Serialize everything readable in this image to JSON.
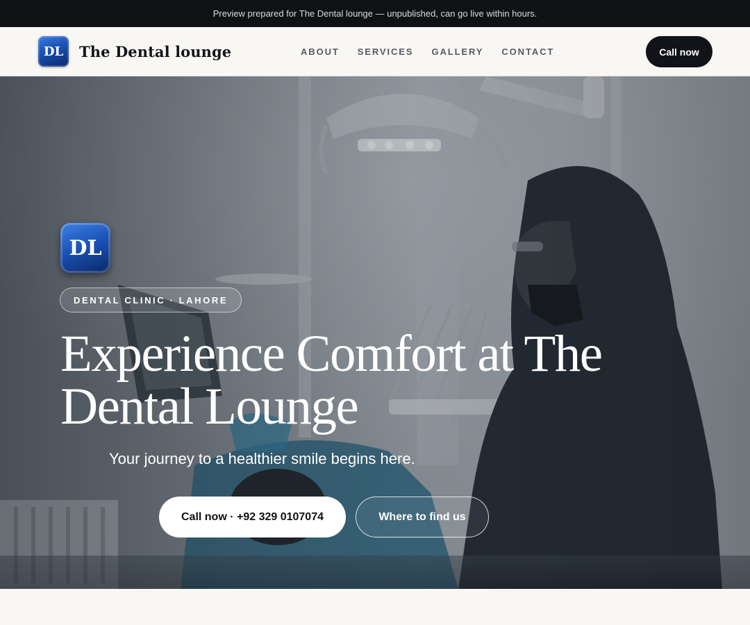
{
  "banner": {
    "text": "Preview prepared for The Dental lounge — unpublished, can go live within hours."
  },
  "header": {
    "logo_initials": "DL",
    "brand_name": "The Dental lounge",
    "nav": [
      "ABOUT",
      "SERVICES",
      "GALLERY",
      "CONTACT"
    ],
    "cta_label": "Call now"
  },
  "hero": {
    "badge_initials": "DL",
    "eyebrow": "DENTAL CLINIC · LAHORE",
    "headline": "Experience Comfort at The Dental Lounge",
    "subheadline": "Your journey to a healthier smile begins here.",
    "primary_button": "Call now · +92 329 0107074",
    "secondary_button": "Where to find us"
  },
  "colors": {
    "banner_bg": "#0f1115",
    "page_bg": "#f8f7f4",
    "brand_blue": "#1a4fb0",
    "dark_button": "#111318"
  }
}
